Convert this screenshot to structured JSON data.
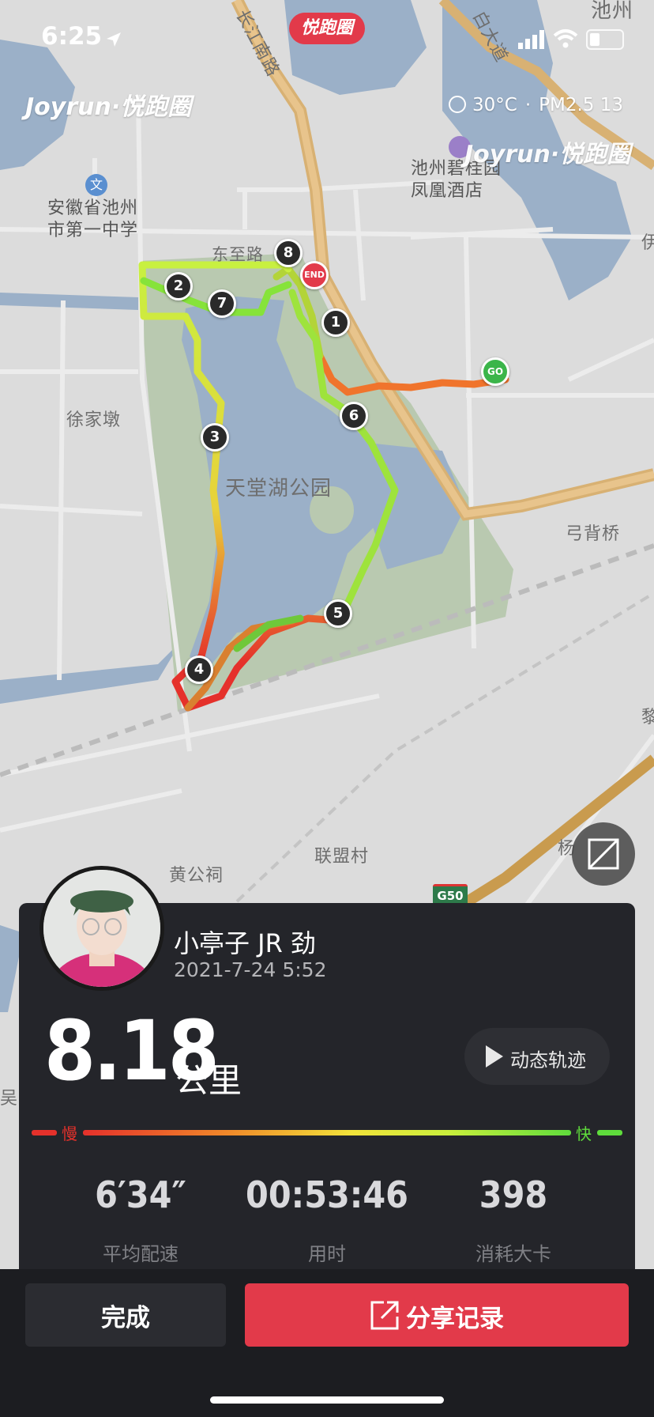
{
  "status_bar": {
    "time": "6:25"
  },
  "top_badge": "悦跑圈",
  "watermark": {
    "brand": "Joyrun·悦跑圈"
  },
  "weather": {
    "temperature": "30°C",
    "separator": "·",
    "air_quality": "PM2.5 13"
  },
  "map": {
    "labels": {
      "road_changjiang": "长江南路",
      "road_east": "东至路",
      "school": "安徽省池州市第一中学",
      "hotel": "池州碧桂园凤凰酒店",
      "village_xu": "徐家墩",
      "park": "天堂湖公园",
      "bridge": "弓背桥",
      "village_huang": "黄公祠",
      "village_lianmeng": "联盟村",
      "highway": "G50",
      "city": "池州",
      "edge_right": "伊",
      "edge_right2": "黎",
      "edge_left": "吴家",
      "edge_yang": "杨",
      "road_ba": "白大道"
    },
    "markers": {
      "start": "GO",
      "end": "END",
      "km": [
        "1",
        "2",
        "3",
        "4",
        "5",
        "6",
        "7",
        "8"
      ]
    }
  },
  "user": {
    "name": "小亭子 JR 劲",
    "date": "2021-7-24 5:52"
  },
  "run": {
    "distance": "8.18",
    "distance_unit": "公里",
    "replay_label": "动态轨迹",
    "pace_scale": {
      "slow": "慢",
      "fast": "快"
    },
    "stats": [
      {
        "value": "6′34″",
        "label": "平均配速"
      },
      {
        "value": "00:53:46",
        "label": "用时"
      },
      {
        "value": "398",
        "label": "消耗大卡"
      }
    ]
  },
  "actions": {
    "done": "完成",
    "share": "分享记录"
  },
  "colors": {
    "accent": "#e23a4a",
    "card": "#24252a",
    "slow": "#e5312b",
    "fast": "#5fdc3c"
  },
  "icons": [
    "location-arrow-icon",
    "signal-icon",
    "wifi-icon",
    "battery-icon",
    "sun-icon",
    "hotel-icon",
    "school-icon",
    "fullscreen-icon",
    "play-icon",
    "share-icon"
  ]
}
